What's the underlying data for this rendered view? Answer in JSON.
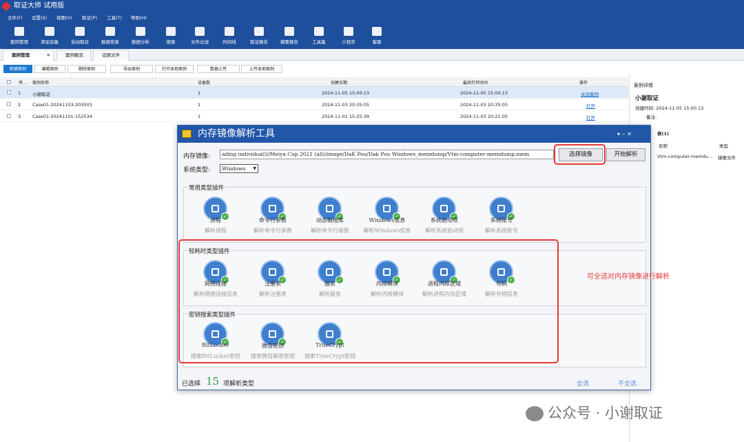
{
  "window": {
    "title": "取证大师 试用版"
  },
  "menu": [
    "文件(F)",
    "设置(S)",
    "视图(V)",
    "取证(P)",
    "工具(T)",
    "帮助(H)"
  ],
  "toolbar": [
    "案例管理",
    "添加设备",
    "自动取证",
    "数据恢复",
    "数据分析",
    "搜索",
    "文件过滤",
    "时间线",
    "取证报告",
    "摘要报告",
    "工具集",
    "小程序",
    "客服"
  ],
  "tabs": [
    {
      "label": "案例管理",
      "close": "✕"
    },
    {
      "label": "案例概览"
    },
    {
      "label": "证据文件"
    }
  ],
  "actions": [
    "新建案例",
    "编辑案例",
    "删除案例",
    "导出案例",
    "打开本地案例",
    "数据上传",
    "上传本地案例"
  ],
  "table": {
    "headers": [
      "序...",
      "案例名称",
      "设备数",
      "创建日期",
      "最后打开时间",
      "操作"
    ],
    "rows": [
      {
        "idx": "1",
        "name": "小谢取证",
        "devices": "1",
        "created": "2024-11-05 15:00:13",
        "opened": "2024-11-05 15:00:13",
        "op": "关闭案例"
      },
      {
        "idx": "2",
        "name": "Case01-20241103-203503",
        "devices": "1",
        "created": "2024-11-03 20:35:05",
        "opened": "2024-11-03 20:35:05",
        "op": "打开"
      },
      {
        "idx": "3",
        "name": "Case01-20241101-152534",
        "devices": "1",
        "created": "2024-11-01 15:25:39",
        "opened": "2024-11-03 20:21:05",
        "op": "打开"
      }
    ]
  },
  "right_panel": {
    "header": "案例详情",
    "case_name": "小谢取证",
    "created": "创建时间: 2024-11-05 15:00:13",
    "remark": "备注:",
    "list_title": "表(1)",
    "col_name": "名称",
    "col_type": "类型",
    "item_name": "Vtm-computer-memdu...",
    "item_type": "镜像文件"
  },
  "dialog": {
    "title": "内存镜像解析工具",
    "controls": "▾ ‒ ✕",
    "image_label": "内存镜像:",
    "image_path": "ading individual))/Meiya Cup 2021 (all)/image/DaK Pou/Dak Pou Windows_memdump/Vtm-computer-memdump.mem",
    "select_btn": "选择镜像",
    "start_btn": "开始解析",
    "os_label": "系统类型:",
    "os_value": "Windows",
    "groups": [
      {
        "title": "常用类型插件",
        "plugins": [
          {
            "name": "进程",
            "desc": "解析进程",
            "icon": "monitor-icon"
          },
          {
            "name": "命令行参数",
            "desc": "解析命令行参数",
            "icon": "code-icon"
          },
          {
            "name": "动态链接库",
            "desc": "解析命令行参数",
            "icon": "link-icon"
          },
          {
            "name": "Windows信息",
            "desc": "解析Windows信息",
            "icon": "info-icon"
          },
          {
            "name": "系统启动项",
            "desc": "解析系统启动项",
            "icon": "disc-icon"
          },
          {
            "name": "系统账号",
            "desc": "解析系统账号",
            "icon": "user-icon"
          }
        ]
      },
      {
        "title": "较耗时类型插件",
        "plugins": [
          {
            "name": "网络连接",
            "desc": "解析网络连接信息",
            "icon": "globe-icon"
          },
          {
            "name": "注册表",
            "desc": "解析注册表",
            "icon": "registry-icon"
          },
          {
            "name": "服务",
            "desc": "解析服务",
            "icon": "service-icon"
          },
          {
            "name": "内核模块",
            "desc": "解析内核模块",
            "icon": "disc-icon"
          },
          {
            "name": "进程内存区域",
            "desc": "解析进程内存区域",
            "icon": "disc-icon"
          },
          {
            "name": "句柄",
            "desc": "解析句柄信息",
            "icon": "document-icon"
          }
        ]
      },
      {
        "title": "密钥搜索类型插件",
        "plugins": [
          {
            "name": "BitLocker",
            "desc": "搜索BitLocker密钥",
            "icon": "lock-icon"
          },
          {
            "name": "微信密钥",
            "desc": "搜索微信解密密钥",
            "icon": "wechat-icon"
          },
          {
            "name": "TrueCrypt",
            "desc": "搜索TrueCrypt密钥",
            "icon": "lock-icon"
          }
        ]
      }
    ],
    "selected_prefix": "已选择",
    "selected_count": "15",
    "selected_suffix": "项解析类型",
    "select_all": "全选",
    "select_none": "不全选"
  },
  "annotation": "可全选对内存镜像进行解析",
  "watermark": "公众号 · 小谢取证",
  "colors": {
    "titlebar": "#1d4f9c",
    "dialog_title": "#2156a8",
    "highlight": "#e53935",
    "plugin": "#3f7fce",
    "check": "#4caf50"
  }
}
